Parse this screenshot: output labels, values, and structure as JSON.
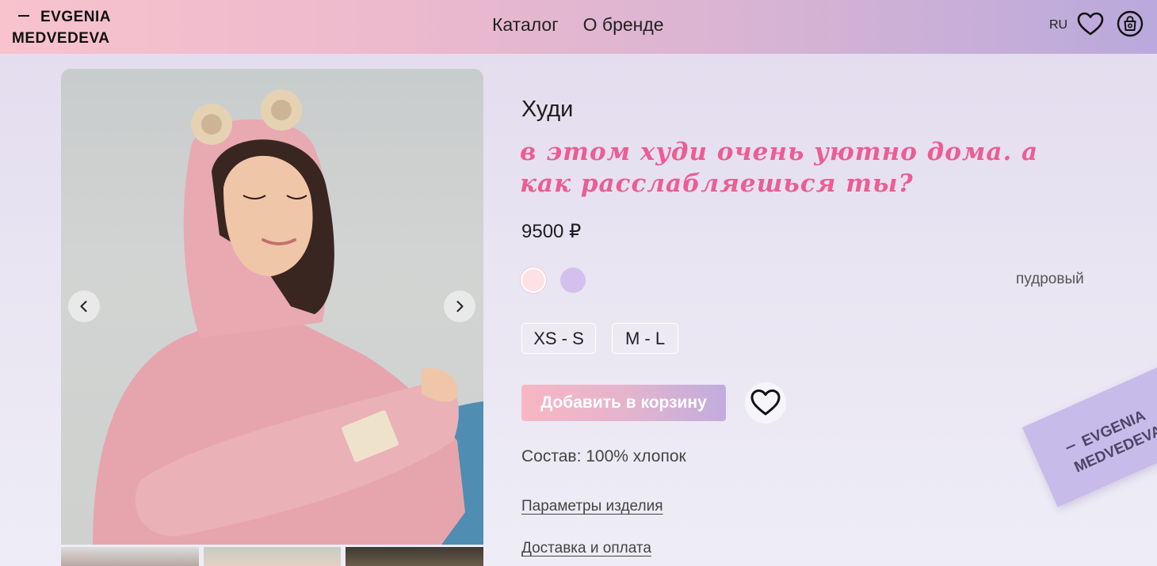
{
  "header": {
    "logo_line1": "EVGENIA",
    "logo_line2": "MEDVEDEVA",
    "nav": [
      "Каталог",
      "О бренде"
    ],
    "lang": "RU"
  },
  "product": {
    "title": "Худи",
    "tagline": "в этом худи очень уютно дома. а как расслабляешься ты?",
    "price": "9500 ₽",
    "colors": [
      {
        "name": "пудровый",
        "hex": "#fde1e3",
        "selected": true
      },
      {
        "hex": "#d4c0ec",
        "selected": false
      }
    ],
    "selected_color_name": "пудровый",
    "sizes": [
      "XS - S",
      "M - L"
    ],
    "add_to_cart": "Добавить в корзину",
    "composition": "Состав: 100% хлопок",
    "links": [
      "Параметры изделия",
      "Доставка и оплата"
    ]
  },
  "decor_tag": {
    "line1": "EVGENIA",
    "line2": "MEDVEDEVA"
  },
  "colors": {
    "accent_pink": "#ec5d93",
    "header_gradient_start": "#f8c3cd",
    "header_gradient_end": "#b9a9dc"
  }
}
